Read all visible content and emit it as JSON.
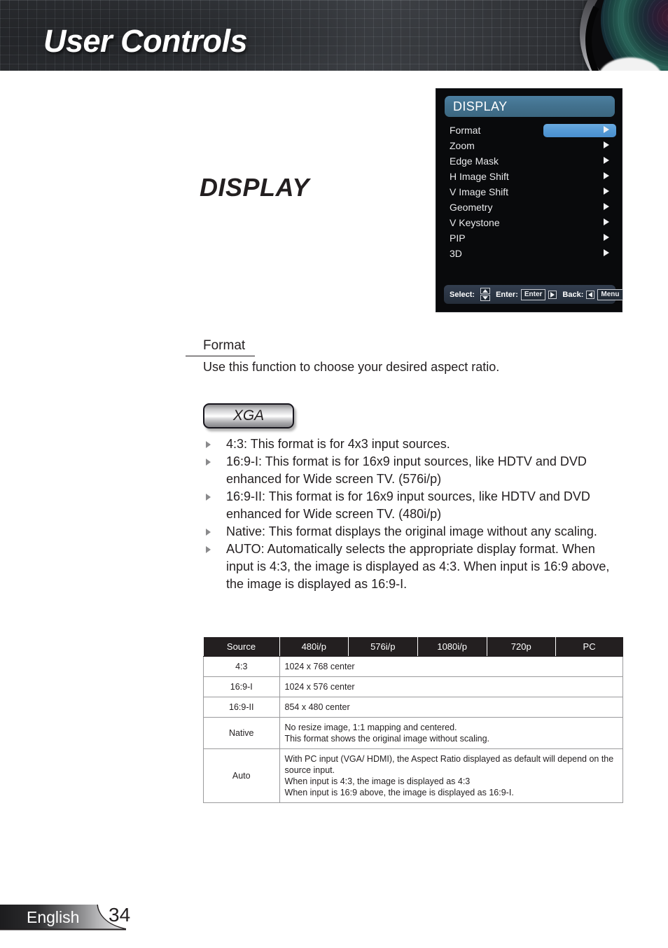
{
  "header": {
    "title": "User Controls",
    "lens_icon": "camera-lens-graphic"
  },
  "osd": {
    "title": "DISPLAY",
    "items": [
      {
        "label": "Format",
        "arrow": "chevron-right",
        "highlighted": true
      },
      {
        "label": "Zoom",
        "arrow": "chevron-right",
        "highlighted": false
      },
      {
        "label": "Edge Mask",
        "arrow": "chevron-right",
        "highlighted": false
      },
      {
        "label": "H Image Shift",
        "arrow": "chevron-right",
        "highlighted": false
      },
      {
        "label": "V Image Shift",
        "arrow": "chevron-right",
        "highlighted": false
      },
      {
        "label": "Geometry",
        "arrow": "chevron-right",
        "highlighted": false
      },
      {
        "label": "V Keystone",
        "arrow": "chevron-right",
        "highlighted": false
      },
      {
        "label": "PIP",
        "arrow": "chevron-right",
        "highlighted": false
      },
      {
        "label": "3D",
        "arrow": "chevron-right",
        "highlighted": false
      }
    ],
    "statusbar": {
      "select_label": "Select:",
      "enter_label": "Enter:",
      "enter_key": "Enter",
      "back_label": "Back:",
      "menu_key": "Menu"
    },
    "colors": {
      "title_bar": "#43728f",
      "highlight": "#559ad6",
      "background": "#090a0c",
      "statusbar": "#2b3544"
    }
  },
  "main": {
    "section_title": "DISPLAY",
    "subhead": "Format",
    "lead": "Use this function to choose your desired aspect ratio.",
    "badge": "XGA",
    "bullets": [
      "4:3: This format is for 4x3 input sources.",
      "16:9-I: This format is for 16x9 input sources, like HDTV and DVD enhanced for Wide screen TV. (576i/p)",
      "16:9-II: This format is for 16x9 input sources, like HDTV and DVD enhanced for Wide screen TV. (480i/p)",
      "Native: This format displays the original image without any scaling.",
      "AUTO: Automatically selects the appropriate display format. When input is 4:3, the image is displayed as 4:3. When input is 16:9 above, the image is displayed as 16:9-I."
    ]
  },
  "table": {
    "headers": [
      "Source",
      "480i/p",
      "576i/p",
      "1080i/p",
      "720p",
      "PC"
    ],
    "rows": [
      {
        "source": "4:3",
        "lines": [
          "1024 x 768 center"
        ]
      },
      {
        "source": "16:9-I",
        "lines": [
          "1024 x 576 center"
        ]
      },
      {
        "source": "16:9-II",
        "lines": [
          "854 x 480 center"
        ]
      },
      {
        "source": "Native",
        "lines": [
          "No resize image, 1:1 mapping and centered.",
          "This format shows the original image without scaling."
        ]
      },
      {
        "source": "Auto",
        "lines": [
          "With PC input (VGA/ HDMI), the Aspect Ratio displayed as default will depend on the source input.",
          "When input is 4:3, the image is displayed as 4:3",
          "When input is 16:9 above, the image is displayed as 16:9-I."
        ]
      }
    ]
  },
  "footer": {
    "language": "English",
    "page_number": "34"
  }
}
